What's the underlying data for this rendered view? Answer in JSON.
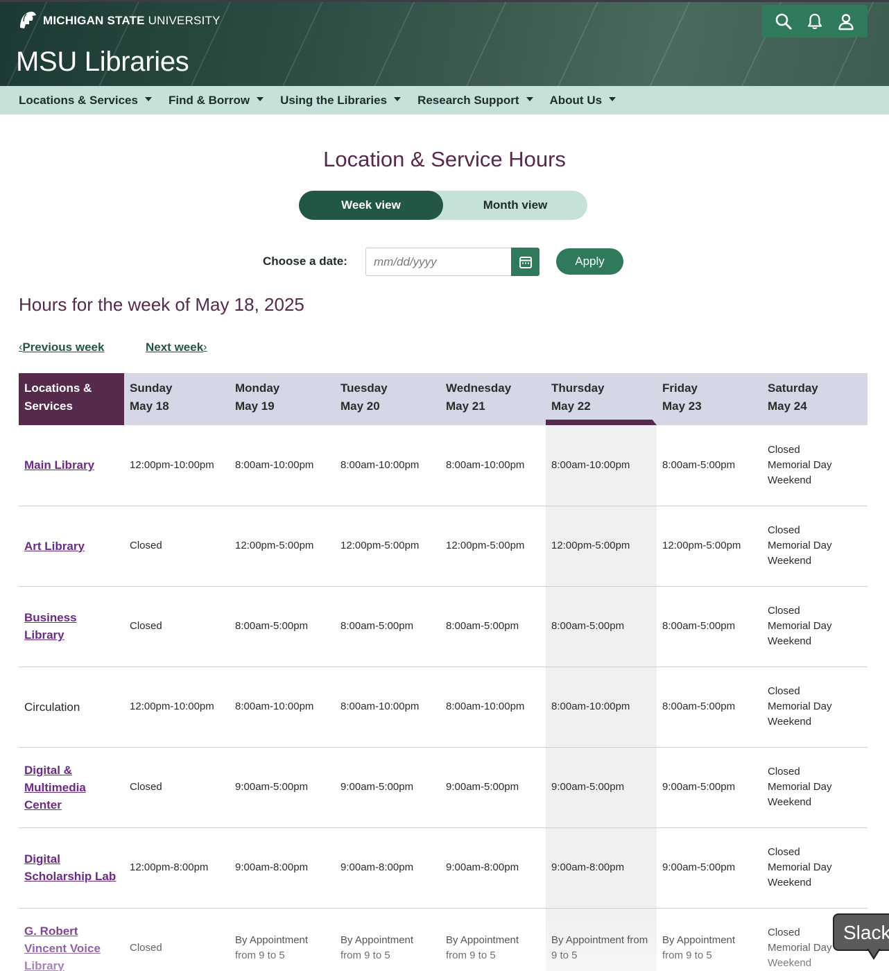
{
  "header": {
    "university_bold": "MICHIGAN STATE",
    "university_light": "UNIVERSITY",
    "site_title": "MSU Libraries",
    "utility_icons": [
      "search-icon",
      "bell-icon",
      "user-icon"
    ]
  },
  "nav": {
    "items": [
      {
        "label": "Locations & Services"
      },
      {
        "label": "Find & Borrow"
      },
      {
        "label": "Using the Libraries"
      },
      {
        "label": "Research Support"
      },
      {
        "label": "About Us"
      }
    ]
  },
  "main": {
    "title": "Location & Service Hours",
    "view_toggle": {
      "week": "Week view",
      "month": "Month view",
      "selected": "Week view"
    },
    "date_picker": {
      "label": "Choose a date:",
      "placeholder": "mm/dd/yyyy",
      "value": "",
      "apply": "Apply"
    },
    "week_heading": "Hours for the week of May 18, 2025",
    "prev_week": "Previous week",
    "next_week": "Next week"
  },
  "table": {
    "corner_header": "Locations & Services",
    "days": [
      {
        "name": "Sunday",
        "date": "May 18"
      },
      {
        "name": "Monday",
        "date": "May 19"
      },
      {
        "name": "Tuesday",
        "date": "May 20"
      },
      {
        "name": "Wednesday",
        "date": "May 21"
      },
      {
        "name": "Thursday",
        "date": "May 22"
      },
      {
        "name": "Friday",
        "date": "May 23"
      },
      {
        "name": "Saturday",
        "date": "May 24"
      }
    ],
    "current_day": "Thursday",
    "rows": [
      {
        "location": "Main Library",
        "link": true,
        "hours": [
          "12:00pm-10:00pm",
          "8:00am-10:00pm",
          "8:00am-10:00pm",
          "8:00am-10:00pm",
          "8:00am-10:00pm",
          "8:00am-5:00pm",
          "Closed Memorial Day Weekend"
        ]
      },
      {
        "location": "Art Library",
        "link": true,
        "hours": [
          "Closed",
          "12:00pm-5:00pm",
          "12:00pm-5:00pm",
          "12:00pm-5:00pm",
          "12:00pm-5:00pm",
          "12:00pm-5:00pm",
          "Closed Memorial Day Weekend"
        ]
      },
      {
        "location": "Business Library",
        "link": true,
        "hours": [
          "Closed",
          "8:00am-5:00pm",
          "8:00am-5:00pm",
          "8:00am-5:00pm",
          "8:00am-5:00pm",
          "8:00am-5:00pm",
          "Closed Memorial Day Weekend"
        ]
      },
      {
        "location": "Circulation",
        "link": false,
        "hours": [
          "12:00pm-10:00pm",
          "8:00am-10:00pm",
          "8:00am-10:00pm",
          "8:00am-10:00pm",
          "8:00am-10:00pm",
          "8:00am-5:00pm",
          "Closed Memorial Day Weekend"
        ]
      },
      {
        "location": "Digital & Multimedia Center",
        "link": true,
        "hours": [
          "Closed",
          "9:00am-5:00pm",
          "9:00am-5:00pm",
          "9:00am-5:00pm",
          "9:00am-5:00pm",
          "9:00am-5:00pm",
          "Closed Memorial Day Weekend"
        ]
      },
      {
        "location": "Digital Scholarship Lab",
        "link": true,
        "hours": [
          "12:00pm-8:00pm",
          "9:00am-8:00pm",
          "9:00am-8:00pm",
          "9:00am-8:00pm",
          "9:00am-8:00pm",
          "9:00am-5:00pm",
          "Closed Memorial Day Weekend"
        ]
      },
      {
        "location": "G. Robert Vincent Voice Library",
        "link": true,
        "hours": [
          "Closed",
          "By Appointment from 9 to 5",
          "By Appointment from 9 to 5",
          "By Appointment from 9 to 5",
          "By Appointment from 9 to 5",
          "By Appointment from 9 to 5",
          "Closed Memorial Day Weekend"
        ]
      }
    ]
  },
  "chat": {
    "label": "Slack"
  },
  "colors": {
    "brand_green": "#225747",
    "accent_green": "#2f7a5b",
    "nav_bg": "#c6e0da",
    "heading_purple": "#562a4b",
    "link_purple": "#6b2a8a",
    "table_header_bg": "#d5d7e6",
    "today_column_bg": "#f0f0f0"
  }
}
